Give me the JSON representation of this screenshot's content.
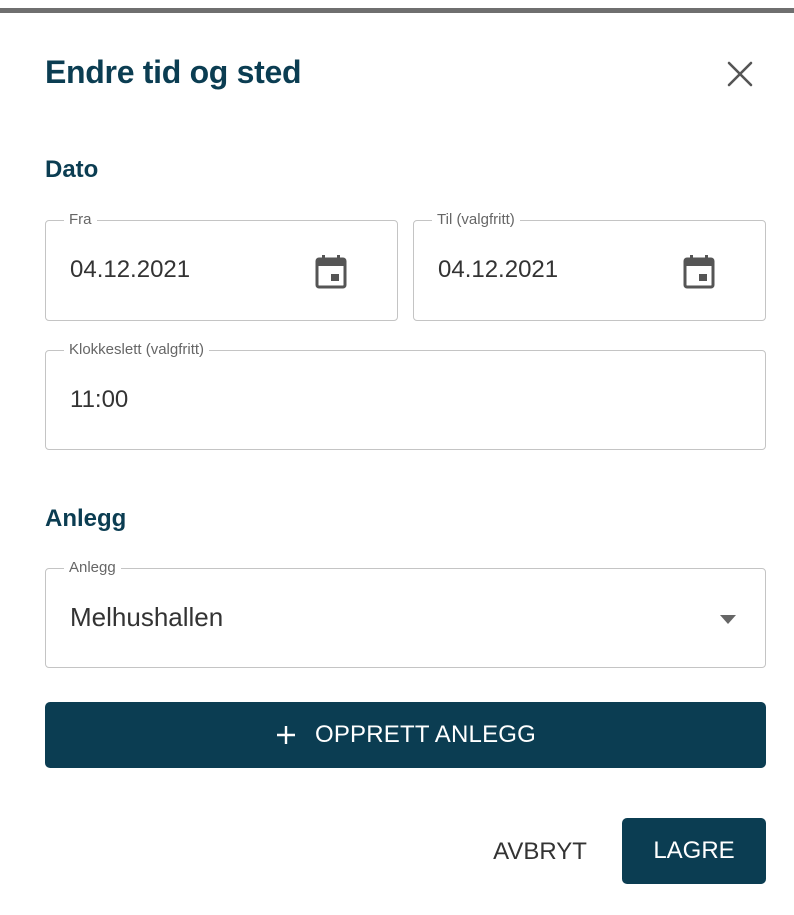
{
  "dialog": {
    "title": "Endre tid og sted",
    "close_icon": "close-icon"
  },
  "date_section": {
    "heading": "Dato",
    "from": {
      "label": "Fra",
      "value": "04.12.2021",
      "icon": "calendar-icon"
    },
    "to": {
      "label": "Til (valgfritt)",
      "value": "04.12.2021",
      "icon": "calendar-icon"
    },
    "time": {
      "label": "Klokkeslett (valgfritt)",
      "value": "11:00"
    }
  },
  "facility_section": {
    "heading": "Anlegg",
    "select": {
      "label": "Anlegg",
      "value": "Melhushallen",
      "icon": "dropdown-caret-icon"
    },
    "create_button": {
      "label": "OPPRETT ANLEGG",
      "icon": "plus-icon"
    }
  },
  "actions": {
    "cancel_label": "AVBRYT",
    "save_label": "LAGRE"
  },
  "colors": {
    "primary": "#0b3d52",
    "border": "#c4c4c4",
    "top_bar": "#6f6f6f"
  }
}
